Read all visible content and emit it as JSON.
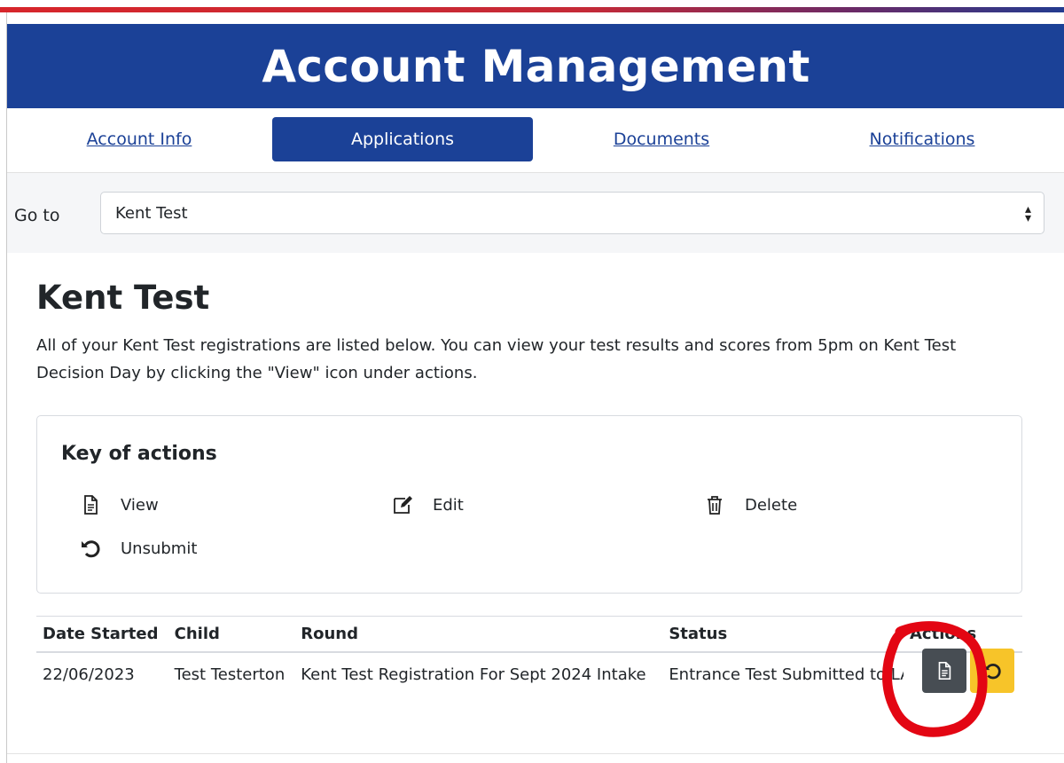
{
  "header": {
    "title": "Account Management"
  },
  "tabs": [
    {
      "label": "Account Info",
      "active": false
    },
    {
      "label": "Applications",
      "active": true
    },
    {
      "label": "Documents",
      "active": false
    },
    {
      "label": "Notifications",
      "active": false
    }
  ],
  "goto": {
    "label": "Go to",
    "selected": "Kent Test"
  },
  "page": {
    "title": "Kent Test",
    "intro": "All of your Kent Test registrations are listed below. You can view your test results and scores from 5pm on Kent Test Decision Day by clicking the \"View\" icon under actions."
  },
  "key": {
    "title": "Key of actions",
    "items": [
      {
        "label": "View",
        "icon": "document-icon"
      },
      {
        "label": "Edit",
        "icon": "edit-icon"
      },
      {
        "label": "Delete",
        "icon": "trash-icon"
      },
      {
        "label": "Unsubmit",
        "icon": "undo-icon"
      }
    ]
  },
  "table": {
    "headers": [
      "Date Started",
      "Child",
      "Round",
      "Status",
      "Actions"
    ],
    "rows": [
      {
        "date": "22/06/2023",
        "child": "Test Testerton",
        "round": "Kent Test Registration For Sept 2024 Intake",
        "status": "Entrance Test Submitted to LA"
      }
    ]
  },
  "colors": {
    "brand_blue": "#1b4197",
    "view_button": "#474d53",
    "unsubmit_button": "#f7c429",
    "annotation_red": "#e30613"
  }
}
